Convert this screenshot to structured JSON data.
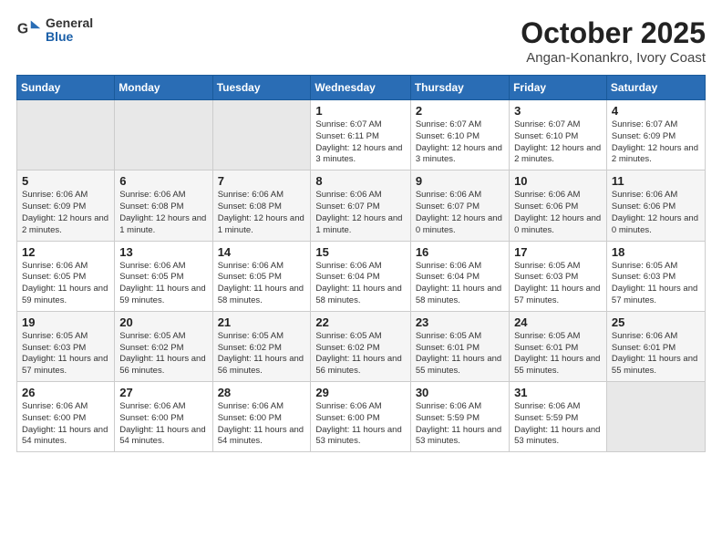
{
  "logo": {
    "general": "General",
    "blue": "Blue"
  },
  "title": "October 2025",
  "location": "Angan-Konankro, Ivory Coast",
  "days_of_week": [
    "Sunday",
    "Monday",
    "Tuesday",
    "Wednesday",
    "Thursday",
    "Friday",
    "Saturday"
  ],
  "weeks": [
    [
      {
        "day": "",
        "info": ""
      },
      {
        "day": "",
        "info": ""
      },
      {
        "day": "",
        "info": ""
      },
      {
        "day": "1",
        "info": "Sunrise: 6:07 AM\nSunset: 6:11 PM\nDaylight: 12 hours and 3 minutes."
      },
      {
        "day": "2",
        "info": "Sunrise: 6:07 AM\nSunset: 6:10 PM\nDaylight: 12 hours and 3 minutes."
      },
      {
        "day": "3",
        "info": "Sunrise: 6:07 AM\nSunset: 6:10 PM\nDaylight: 12 hours and 2 minutes."
      },
      {
        "day": "4",
        "info": "Sunrise: 6:07 AM\nSunset: 6:09 PM\nDaylight: 12 hours and 2 minutes."
      }
    ],
    [
      {
        "day": "5",
        "info": "Sunrise: 6:06 AM\nSunset: 6:09 PM\nDaylight: 12 hours and 2 minutes."
      },
      {
        "day": "6",
        "info": "Sunrise: 6:06 AM\nSunset: 6:08 PM\nDaylight: 12 hours and 1 minute."
      },
      {
        "day": "7",
        "info": "Sunrise: 6:06 AM\nSunset: 6:08 PM\nDaylight: 12 hours and 1 minute."
      },
      {
        "day": "8",
        "info": "Sunrise: 6:06 AM\nSunset: 6:07 PM\nDaylight: 12 hours and 1 minute."
      },
      {
        "day": "9",
        "info": "Sunrise: 6:06 AM\nSunset: 6:07 PM\nDaylight: 12 hours and 0 minutes."
      },
      {
        "day": "10",
        "info": "Sunrise: 6:06 AM\nSunset: 6:06 PM\nDaylight: 12 hours and 0 minutes."
      },
      {
        "day": "11",
        "info": "Sunrise: 6:06 AM\nSunset: 6:06 PM\nDaylight: 12 hours and 0 minutes."
      }
    ],
    [
      {
        "day": "12",
        "info": "Sunrise: 6:06 AM\nSunset: 6:05 PM\nDaylight: 11 hours and 59 minutes."
      },
      {
        "day": "13",
        "info": "Sunrise: 6:06 AM\nSunset: 6:05 PM\nDaylight: 11 hours and 59 minutes."
      },
      {
        "day": "14",
        "info": "Sunrise: 6:06 AM\nSunset: 6:05 PM\nDaylight: 11 hours and 58 minutes."
      },
      {
        "day": "15",
        "info": "Sunrise: 6:06 AM\nSunset: 6:04 PM\nDaylight: 11 hours and 58 minutes."
      },
      {
        "day": "16",
        "info": "Sunrise: 6:06 AM\nSunset: 6:04 PM\nDaylight: 11 hours and 58 minutes."
      },
      {
        "day": "17",
        "info": "Sunrise: 6:05 AM\nSunset: 6:03 PM\nDaylight: 11 hours and 57 minutes."
      },
      {
        "day": "18",
        "info": "Sunrise: 6:05 AM\nSunset: 6:03 PM\nDaylight: 11 hours and 57 minutes."
      }
    ],
    [
      {
        "day": "19",
        "info": "Sunrise: 6:05 AM\nSunset: 6:03 PM\nDaylight: 11 hours and 57 minutes."
      },
      {
        "day": "20",
        "info": "Sunrise: 6:05 AM\nSunset: 6:02 PM\nDaylight: 11 hours and 56 minutes."
      },
      {
        "day": "21",
        "info": "Sunrise: 6:05 AM\nSunset: 6:02 PM\nDaylight: 11 hours and 56 minutes."
      },
      {
        "day": "22",
        "info": "Sunrise: 6:05 AM\nSunset: 6:02 PM\nDaylight: 11 hours and 56 minutes."
      },
      {
        "day": "23",
        "info": "Sunrise: 6:05 AM\nSunset: 6:01 PM\nDaylight: 11 hours and 55 minutes."
      },
      {
        "day": "24",
        "info": "Sunrise: 6:05 AM\nSunset: 6:01 PM\nDaylight: 11 hours and 55 minutes."
      },
      {
        "day": "25",
        "info": "Sunrise: 6:06 AM\nSunset: 6:01 PM\nDaylight: 11 hours and 55 minutes."
      }
    ],
    [
      {
        "day": "26",
        "info": "Sunrise: 6:06 AM\nSunset: 6:00 PM\nDaylight: 11 hours and 54 minutes."
      },
      {
        "day": "27",
        "info": "Sunrise: 6:06 AM\nSunset: 6:00 PM\nDaylight: 11 hours and 54 minutes."
      },
      {
        "day": "28",
        "info": "Sunrise: 6:06 AM\nSunset: 6:00 PM\nDaylight: 11 hours and 54 minutes."
      },
      {
        "day": "29",
        "info": "Sunrise: 6:06 AM\nSunset: 6:00 PM\nDaylight: 11 hours and 53 minutes."
      },
      {
        "day": "30",
        "info": "Sunrise: 6:06 AM\nSunset: 5:59 PM\nDaylight: 11 hours and 53 minutes."
      },
      {
        "day": "31",
        "info": "Sunrise: 6:06 AM\nSunset: 5:59 PM\nDaylight: 11 hours and 53 minutes."
      },
      {
        "day": "",
        "info": ""
      }
    ]
  ]
}
